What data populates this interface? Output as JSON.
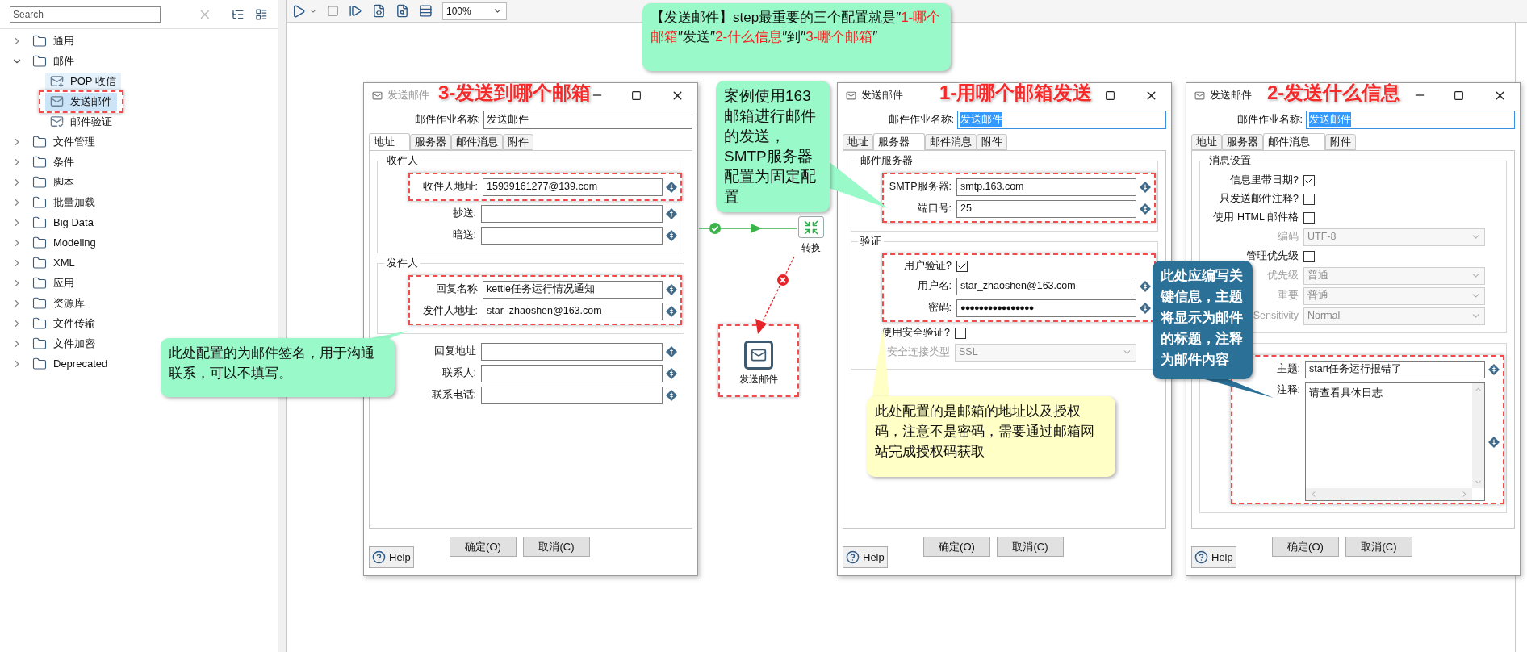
{
  "sidebar": {
    "search": {
      "placeholder": "Search"
    },
    "tree": [
      {
        "label": "通用",
        "expanded": false
      },
      {
        "label": "邮件",
        "expanded": true,
        "children": [
          {
            "label": "POP 收信",
            "kind": "receive",
            "selected": false,
            "hovered": true,
            "highlighted": false
          },
          {
            "label": "发送邮件",
            "kind": "send",
            "selected": true,
            "hovered": false,
            "highlighted": true
          },
          {
            "label": "邮件验证",
            "kind": "verify",
            "selected": false,
            "hovered": false,
            "highlighted": false
          }
        ]
      },
      {
        "label": "文件管理",
        "expanded": false
      },
      {
        "label": "条件",
        "expanded": false
      },
      {
        "label": "脚本",
        "expanded": false
      },
      {
        "label": "批量加载",
        "expanded": false
      },
      {
        "label": "Big Data",
        "expanded": false
      },
      {
        "label": "Modeling",
        "expanded": false
      },
      {
        "label": "XML",
        "expanded": false
      },
      {
        "label": "应用",
        "expanded": false
      },
      {
        "label": "资源库",
        "expanded": false
      },
      {
        "label": "文件传输",
        "expanded": false
      },
      {
        "label": "文件加密",
        "expanded": false
      },
      {
        "label": "Deprecated",
        "expanded": false
      }
    ]
  },
  "toolbar": {
    "zoom": "100%"
  },
  "canvas": {
    "nodes": [
      {
        "label": "转换",
        "kind": "transform",
        "highlighted": false
      },
      {
        "label": "发送邮件",
        "kind": "mail",
        "highlighted": true
      }
    ]
  },
  "dialogs": [
    {
      "title": "发送邮件",
      "annotation": "3-发送到哪个邮箱",
      "minimize": true,
      "job_name": {
        "label": "邮件作业名称:",
        "value": "发送邮件",
        "focused": false
      },
      "tabs": [
        {
          "label": "地址",
          "selected": true
        },
        {
          "label": "服务器",
          "selected": false
        },
        {
          "label": "邮件消息",
          "selected": false
        },
        {
          "label": "附件",
          "selected": false
        }
      ],
      "sections": [
        {
          "kind": "group",
          "label": "收件人",
          "rows": [
            {
              "kind": "text",
              "label": "收件人地址:",
              "value": "15939161277@139.com",
              "highlighted": true
            },
            {
              "kind": "text",
              "label": "抄送:",
              "highlighted": false
            },
            {
              "kind": "text",
              "label": "暗送:",
              "highlighted": false
            }
          ]
        },
        {
          "kind": "group",
          "label": "发件人",
          "rows": [
            {
              "kind": "text",
              "label": "回复名称",
              "value": "kettle任务运行情况通知",
              "highlighted": true
            },
            {
              "kind": "text",
              "label": "发件人地址:",
              "value": "star_zhaoshen@163.com",
              "highlighted": true
            }
          ]
        },
        {
          "kind": "plain",
          "rows": [
            {
              "kind": "text",
              "label": "回复地址",
              "highlighted": false
            },
            {
              "kind": "text",
              "label": "联系人:",
              "highlighted": false
            },
            {
              "kind": "text",
              "label": "联系电话:",
              "highlighted": false
            }
          ]
        }
      ],
      "buttons": [
        "确定(O)",
        "取消(C)"
      ],
      "help": "Help"
    },
    {
      "title": "发送邮件",
      "annotation": "1-用哪个邮箱发送",
      "minimize": false,
      "job_name": {
        "label": "邮件作业名称:",
        "value": "发送邮件",
        "focused": true
      },
      "tabs": [
        {
          "label": "地址",
          "selected": false
        },
        {
          "label": "服务器",
          "selected": true
        },
        {
          "label": "邮件消息",
          "selected": false
        },
        {
          "label": "附件",
          "selected": false
        }
      ],
      "sections": [
        {
          "kind": "group",
          "label": "邮件服务器",
          "rows": [
            {
              "kind": "text",
              "label": "SMTP服务器:",
              "value": "smtp.163.com",
              "highlighted": true
            },
            {
              "kind": "text",
              "label": "端口号:",
              "value": "25",
              "highlighted": true
            }
          ]
        },
        {
          "kind": "group",
          "label": "验证",
          "rows": [
            {
              "kind": "checkbox",
              "label": "用户验证?",
              "checked": true,
              "highlighted": true
            },
            {
              "kind": "text",
              "label": "用户名:",
              "value": "star_zhaoshen@163.com",
              "highlighted": true
            },
            {
              "kind": "password",
              "label": "密码:",
              "value": "●●●●●●●●●●●●●●●●",
              "highlighted": true
            },
            {
              "kind": "checkbox",
              "label": "使用安全验证?",
              "checked": false,
              "highlighted": false
            },
            {
              "kind": "select",
              "label": "安全连接类型",
              "value": "SSL",
              "disabled": true,
              "highlighted": false
            }
          ]
        }
      ],
      "buttons": [
        "确定(O)",
        "取消(C)"
      ],
      "help": "Help"
    },
    {
      "title": "发送邮件",
      "annotation": "2-发送什么信息",
      "minimize": true,
      "job_name": {
        "label": "邮件作业名称:",
        "value": "发送邮件",
        "focused": true
      },
      "tabs": [
        {
          "label": "地址",
          "selected": false
        },
        {
          "label": "服务器",
          "selected": false
        },
        {
          "label": "邮件消息",
          "selected": true
        },
        {
          "label": "附件",
          "selected": false
        }
      ],
      "sections": [
        {
          "kind": "group",
          "label": "消息设置",
          "rows": [
            {
              "kind": "checkbox",
              "label": "信息里带日期?",
              "checked": true,
              "highlighted": false
            },
            {
              "kind": "checkbox",
              "label": "只发送邮件注释?",
              "checked": false,
              "highlighted": false
            },
            {
              "kind": "checkbox",
              "label": "使用 HTML 邮件格",
              "checked": false,
              "highlighted": false
            },
            {
              "kind": "select",
              "label": "编码",
              "value": "UTF-8",
              "disabled": true,
              "highlighted": false
            },
            {
              "kind": "checkbox",
              "label": "管理优先级",
              "checked": false,
              "highlighted": false
            },
            {
              "kind": "select",
              "label": "优先级",
              "value": "普通",
              "disabled": true,
              "highlighted": false
            },
            {
              "kind": "select",
              "label": "重要",
              "value": "普通",
              "disabled": true,
              "highlighted": false
            },
            {
              "kind": "select",
              "label": "Sensitivity",
              "value": "Normal",
              "disabled": true,
              "highlighted": false
            }
          ]
        },
        {
          "kind": "group",
          "rows": [
            {
              "kind": "text",
              "label": "主题:",
              "value": "start任务运行报错了",
              "highlighted": true
            },
            {
              "kind": "textarea",
              "label": "注释:",
              "value": "请查看具体日志",
              "highlighted": true
            }
          ]
        }
      ],
      "buttons": [
        "确定(O)",
        "取消(C)"
      ],
      "help": "Help"
    }
  ],
  "callouts": [
    {
      "color": "#99f9c9",
      "segments": [
        {
          "text": "【发送邮件】step最重要的三个配置就是″",
          "emphasis": false
        },
        {
          "text": "1-哪个邮箱",
          "emphasis": true
        },
        {
          "text": "″发送″",
          "emphasis": false
        },
        {
          "text": "2-什么信息",
          "emphasis": true
        },
        {
          "text": "″到″",
          "emphasis": false
        },
        {
          "text": "3-哪个邮箱",
          "emphasis": true
        },
        {
          "text": "″",
          "emphasis": false
        }
      ]
    },
    {
      "color": "#99f9c9",
      "text": "案例使用163邮箱进行邮件的发送，SMTP服务器配置为固定配置"
    },
    {
      "color": "#99f9c9",
      "text": "此处配置的为邮件签名，用于沟通联系，可以不填写。"
    },
    {
      "color": "#ffffc6",
      "text": "此处配置的是邮箱的地址以及授权码，注意不是密码，需要通过邮箱网站完成授权码获取"
    },
    {
      "color": "#2b7097",
      "text": "此处应编写关键信息，主题将显示为邮件的标题，注释为邮件内容"
    }
  ]
}
